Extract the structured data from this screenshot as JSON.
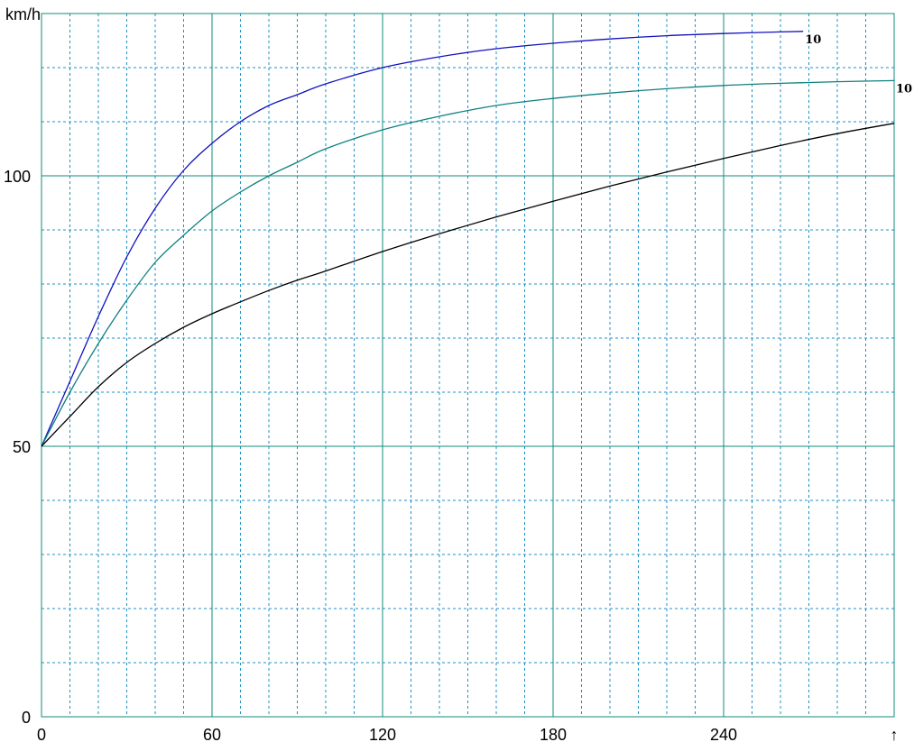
{
  "chart_data": {
    "type": "line",
    "ylabel": "km/h",
    "xlabel": "",
    "xlim": [
      0,
      300
    ],
    "ylim": [
      0,
      130
    ],
    "x_ticks": [
      0,
      60,
      120,
      180,
      240
    ],
    "x_tick_labels": [
      "0",
      "60",
      "120",
      "180",
      "240"
    ],
    "y_ticks": [
      0,
      50,
      100
    ],
    "y_tick_labels": [
      "0",
      "50",
      "100"
    ],
    "x_major_step": 60,
    "x_minor_step": 10,
    "y_major_step": 50,
    "y_minor_step": 10,
    "grid": true,
    "end_marker": "↑",
    "series": [
      {
        "color": "#1010c0",
        "end_label": "10",
        "x": [
          0,
          10,
          20,
          30,
          40,
          50,
          60,
          70,
          80,
          90,
          100,
          120,
          140,
          160,
          180,
          200,
          220,
          240,
          260,
          268
        ],
        "y": [
          50,
          62,
          74,
          85,
          94,
          101,
          106,
          110,
          113,
          115,
          117,
          120,
          122,
          123.5,
          124.5,
          125.3,
          125.9,
          126.3,
          126.6,
          126.7
        ]
      },
      {
        "color": "#108080",
        "end_label": "10",
        "x": [
          0,
          10,
          20,
          30,
          40,
          50,
          60,
          70,
          80,
          90,
          100,
          120,
          140,
          160,
          180,
          200,
          220,
          240,
          260,
          280,
          300
        ],
        "y": [
          50,
          60,
          69,
          77,
          84,
          89,
          93.5,
          97,
          100,
          102.5,
          105,
          108.5,
          111,
          113,
          114.3,
          115.3,
          116.1,
          116.7,
          117.1,
          117.4,
          117.6
        ]
      },
      {
        "color": "#000000",
        "end_label": "",
        "x": [
          0,
          10,
          20,
          30,
          40,
          50,
          60,
          70,
          80,
          90,
          100,
          120,
          140,
          160,
          180,
          200,
          220,
          240,
          260,
          280,
          300
        ],
        "y": [
          50,
          55.5,
          61,
          65.5,
          69,
          72,
          74.5,
          76.7,
          78.8,
          80.7,
          82.4,
          86,
          89.3,
          92.4,
          95.3,
          98.1,
          100.7,
          103.2,
          105.6,
          107.8,
          109.7
        ]
      }
    ]
  },
  "colors": {
    "major_grid": "#0f8c7a",
    "minor_grid": "#1e90c8",
    "background": "#ffffff"
  }
}
